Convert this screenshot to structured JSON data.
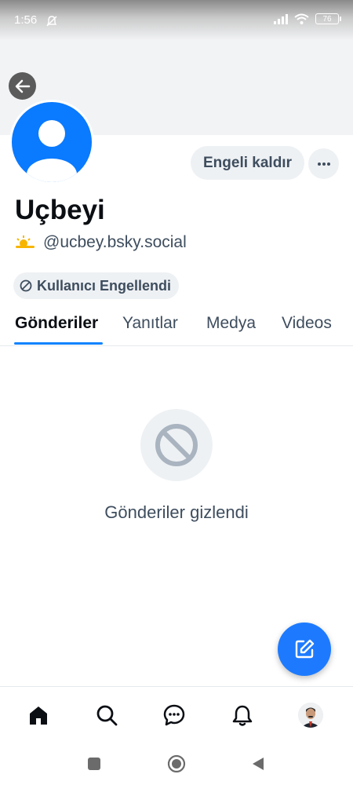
{
  "status_bar": {
    "time": "1:56",
    "battery": "76"
  },
  "profile": {
    "display_name": "Uçbeyi",
    "handle": "@ucbey.bsky.social",
    "unblock_label": "Engeli kaldır",
    "blocked_label": "Kullanıcı Engellendi"
  },
  "tabs": [
    {
      "label": "Gönderiler",
      "active": true
    },
    {
      "label": "Yanıtlar",
      "active": false
    },
    {
      "label": "Medya",
      "active": false
    },
    {
      "label": "Videos",
      "active": false
    }
  ],
  "empty_state": {
    "message": "Gönderiler gizlendi"
  },
  "icons": {
    "back": "arrow-left-icon",
    "more": "ellipsis-icon",
    "handle_emoji": "sun-behind-cloud-icon",
    "blocked": "block-icon",
    "empty": "block-icon",
    "fab": "compose-icon",
    "nav": [
      "home-icon",
      "search-icon",
      "chat-icon",
      "bell-icon",
      "profile-avatar"
    ]
  },
  "colors": {
    "accent": "#1083fe",
    "avatar_bg": "#0a7aff",
    "fab_bg": "#1d7aff",
    "muted_text": "#3e4d5e",
    "pill_bg": "#eef1f4"
  }
}
